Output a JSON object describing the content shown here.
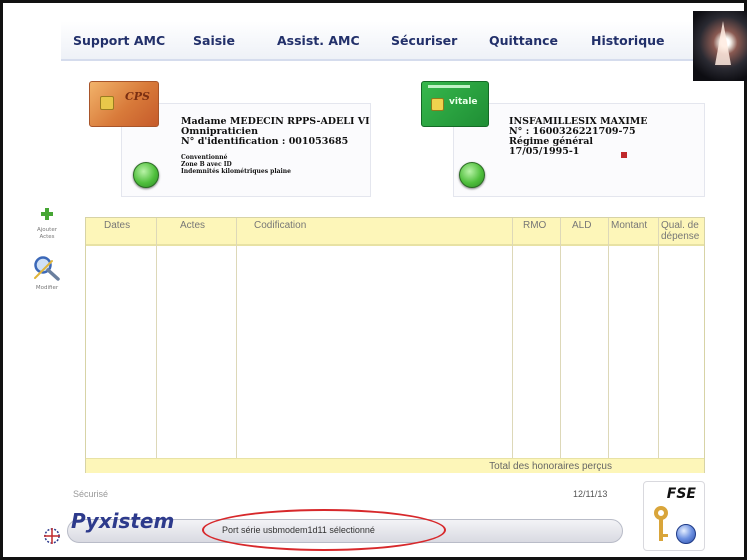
{
  "nav": {
    "items": [
      "Support AMC",
      "Saisie",
      "Assist. AMC",
      "Sécuriser",
      "Quittance",
      "Historique"
    ]
  },
  "cards": {
    "cps_label": "CPS",
    "vitale_label": "vitale"
  },
  "practitioner": {
    "name": "Madame MEDECIN RPPS-ADELI VI",
    "specialty": "Omnipraticien",
    "id_line": "N° d'identification : 001053685",
    "details": [
      "Conventionné",
      "Zone B avec ID",
      "Indemnités kilométriques plaine"
    ]
  },
  "patient": {
    "name": "INSFAMILLESIX MAXIME",
    "number": "N° : 1600326221709-75",
    "regime": "Régime général",
    "birth": "17/05/1995-1"
  },
  "tools": {
    "add_label": "Ajouter Actes",
    "edit_label": "Modifier"
  },
  "table": {
    "columns": [
      "Dates",
      "Actes",
      "Codification",
      "RMO",
      "ALD",
      "Montant",
      "Qual. de dépense"
    ],
    "rows": [],
    "total_label": "Total des honoraires perçus"
  },
  "footer": {
    "secured_label": "Sécurisé",
    "date": "12/11/13",
    "fse_label": "FSE",
    "brand": "Pyxistem",
    "status": "Port série usbmodem1d11 sélectionné"
  },
  "colors": {
    "nav_text": "#22306a",
    "table_header": "#fdf6b9",
    "highlight_oval": "#d7282b",
    "brand": "#2d3a8c"
  }
}
